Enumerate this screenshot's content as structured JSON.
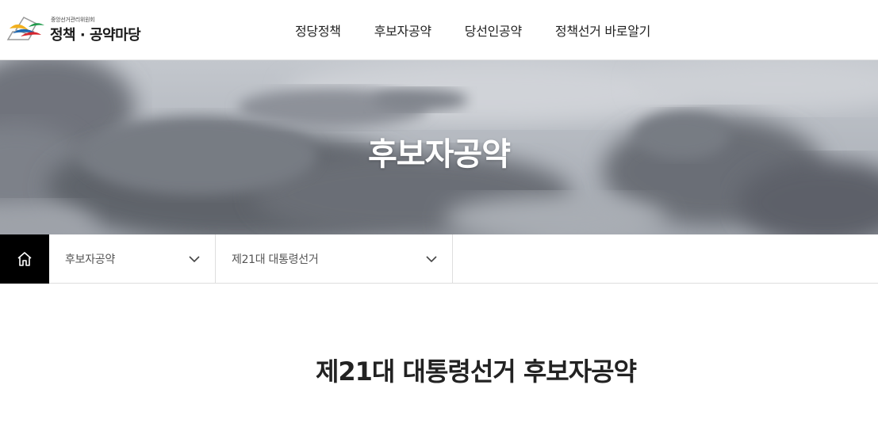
{
  "header": {
    "logo": {
      "org_name": "중앙선거관리위원회",
      "title": "정책 · 공약마당"
    },
    "nav": [
      {
        "label": "정당정책"
      },
      {
        "label": "후보자공약"
      },
      {
        "label": "당선인공약"
      },
      {
        "label": "정책선거 바로알기"
      }
    ]
  },
  "hero": {
    "title": "후보자공약"
  },
  "location_bar": {
    "home_icon": "home-icon",
    "menu_select": {
      "value": "후보자공약"
    },
    "election_select": {
      "value": "제21대 대통령선거"
    }
  },
  "content": {
    "page_title": "제21대 대통령선거 후보자공약"
  },
  "colors": {
    "home_button_bg": "#000000",
    "hero_sky": "#a8adb6",
    "text_dark": "#222222"
  }
}
